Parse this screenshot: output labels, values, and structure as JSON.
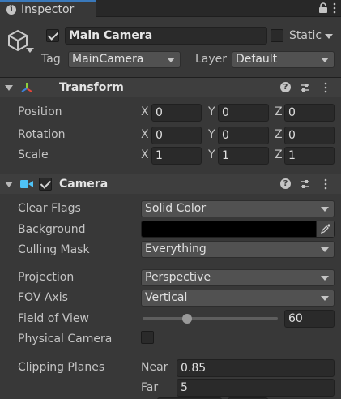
{
  "window": {
    "tab_title": "Inspector"
  },
  "header": {
    "active_checked": true,
    "object_name": "Main Camera",
    "static_label": "Static",
    "static_checked": false,
    "tag_label": "Tag",
    "tag_value": "MainCamera",
    "layer_label": "Layer",
    "layer_value": "Default"
  },
  "transform": {
    "title": "Transform",
    "rows": [
      {
        "label": "Position",
        "x": "0",
        "y": "0",
        "z": "0"
      },
      {
        "label": "Rotation",
        "x": "0",
        "y": "0",
        "z": "0"
      },
      {
        "label": "Scale",
        "x": "1",
        "y": "1",
        "z": "1"
      }
    ],
    "axes": {
      "x": "X",
      "y": "Y",
      "z": "Z"
    }
  },
  "camera": {
    "title": "Camera",
    "enabled": true,
    "clear_flags_label": "Clear Flags",
    "clear_flags_value": "Solid Color",
    "background_label": "Background",
    "background_color": "#000000",
    "culling_mask_label": "Culling Mask",
    "culling_mask_value": "Everything",
    "projection_label": "Projection",
    "projection_value": "Perspective",
    "fov_axis_label": "FOV Axis",
    "fov_axis_value": "Vertical",
    "fov_label": "Field of View",
    "fov_value": "60",
    "fov_slider_fraction": 0.33,
    "physical_camera_label": "Physical Camera",
    "physical_camera_checked": false,
    "clipping_label": "Clipping Planes",
    "near_label": "Near",
    "near_value": "0.85",
    "far_label": "Far",
    "far_value": "5"
  },
  "colors": {
    "panel_bg": "#383838",
    "tab_accent": "#3a79bb",
    "camera_icon": "#4fc3f7"
  }
}
